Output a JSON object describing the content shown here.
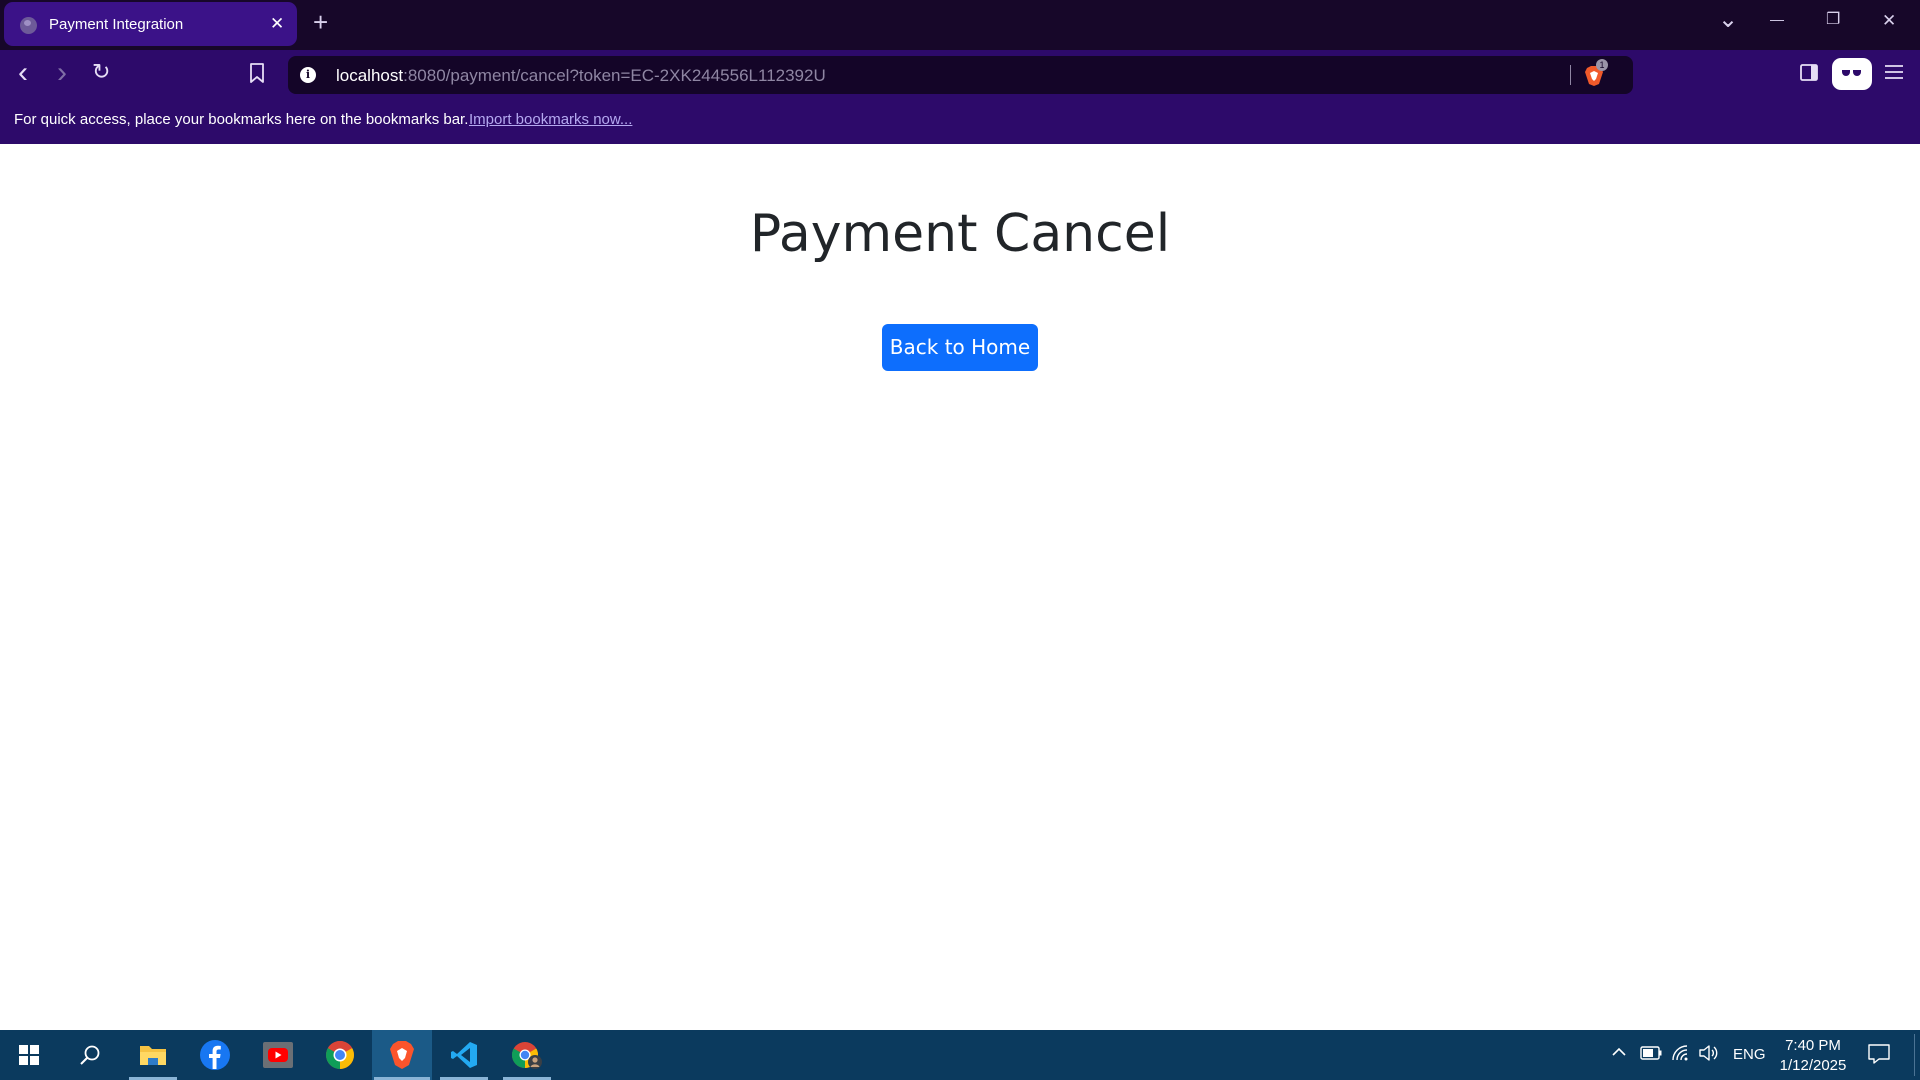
{
  "browser": {
    "tab": {
      "title": "Payment Integration",
      "close_glyph": "✕"
    },
    "new_tab_glyph": "+",
    "window_controls": {
      "tab_search": "⌄",
      "minimize": "—",
      "restore": "❐",
      "close": "✕"
    },
    "nav": {
      "back": "‹",
      "forward": "›",
      "reload": "↻"
    },
    "address_bar": {
      "host": "localhost",
      "path": ":8080/payment/cancel?token=EC-2XK244556L112392U"
    },
    "brave_shields_count": "1",
    "bookmarks_bar": {
      "message": "For quick access, place your bookmarks here on the bookmarks bar.",
      "import_link": "Import bookmarks now..."
    }
  },
  "page": {
    "title": "Payment Cancel",
    "back_button_label": "Back to Home",
    "accent_color": "#0d6efd"
  },
  "taskbar": {
    "apps": [
      "windows-start-icon",
      "search-icon",
      "file-explorer-icon",
      "facebook-icon",
      "youtube-icon",
      "chrome-icon",
      "brave-icon",
      "vscode-icon",
      "chrome-profile-icon"
    ],
    "tray": {
      "language": "ENG"
    },
    "clock": {
      "time": "7:40 PM",
      "date": "1/12/2025"
    }
  }
}
